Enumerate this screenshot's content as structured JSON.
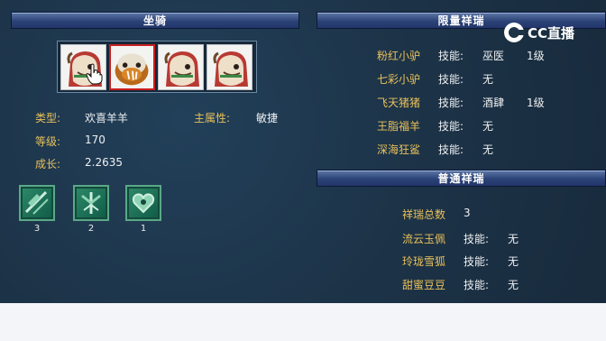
{
  "mount_header": "坐骑",
  "limited_header": "限量祥瑞",
  "normal_header": "普通祥瑞",
  "logo_text": "CC直播",
  "pet": {
    "type_label": "类型:",
    "type_value": "欢喜羊羊",
    "attr_label": "主属性:",
    "attr_value": "敏捷",
    "level_label": "等级:",
    "level_value": "170",
    "growth_label": "成长:",
    "growth_value": "2.2635"
  },
  "skills": [
    {
      "count": "3",
      "icon": "claw-crest-icon"
    },
    {
      "count": "2",
      "icon": "trident-crest-icon"
    },
    {
      "count": "1",
      "icon": "heart-crest-icon"
    }
  ],
  "limited": [
    {
      "name": "粉红小驴",
      "skill_label": "技能:",
      "skill": "巫医",
      "level": "1级"
    },
    {
      "name": "七彩小驴",
      "skill_label": "技能:",
      "skill": "无",
      "level": ""
    },
    {
      "name": "飞天猪猪",
      "skill_label": "技能:",
      "skill": "酒肆",
      "level": "1级"
    },
    {
      "name": "王脂福羊",
      "skill_label": "技能:",
      "skill": "无",
      "level": ""
    },
    {
      "name": "深海狂鲨",
      "skill_label": "技能:",
      "skill": "无",
      "level": ""
    }
  ],
  "normal": {
    "total_label": "祥瑞总数",
    "total_value": "3",
    "items": [
      {
        "name": "流云玉佩",
        "skill_label": "技能:",
        "skill": "无"
      },
      {
        "name": "玲珑雪狐",
        "skill_label": "技能:",
        "skill": "无"
      },
      {
        "name": "甜蜜豆豆",
        "skill_label": "技能:",
        "skill": "无"
      }
    ]
  },
  "colors": {
    "panel_bg": "#1d3447",
    "label_gold": "#e8c05b",
    "value_white": "#eef0f2",
    "selected_border": "#c81e1e"
  }
}
